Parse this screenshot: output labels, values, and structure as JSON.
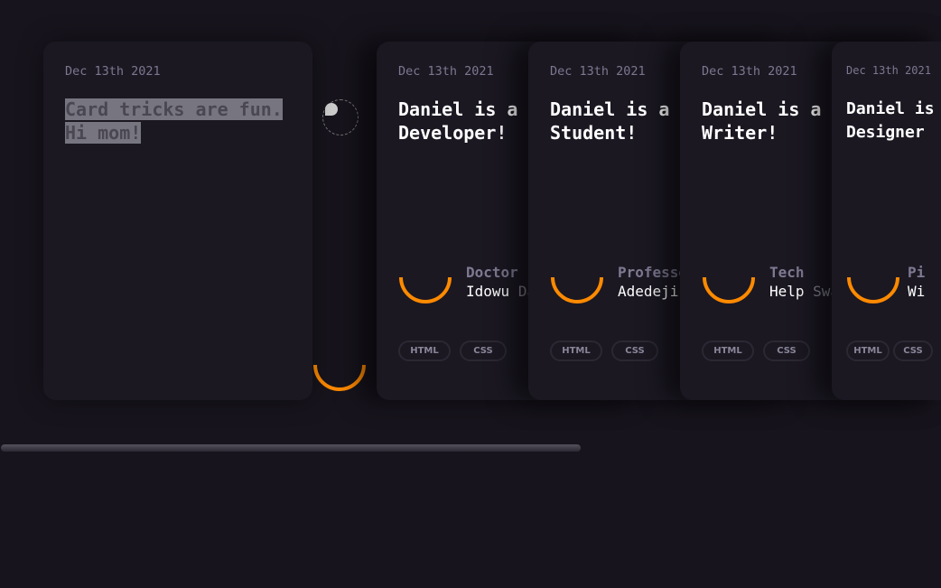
{
  "accent_color": "#ff8a00",
  "first_card": {
    "date": "Dec 13th 2021",
    "title_line1": "Card tricks are fun.",
    "title_line2": "Hi mom!"
  },
  "avatar_icon": "broken-image-icon",
  "cards": [
    {
      "date": "Dec 13th 2021",
      "title_line1": "Daniel is a",
      "title_line2": "Developer!",
      "role": "Doctor",
      "name_first": "Idowu",
      "name_rest": "Da",
      "tags": [
        "HTML",
        "CSS"
      ]
    },
    {
      "date": "Dec 13th 2021",
      "title_line1": "Daniel is a",
      "title_line2": "Student!",
      "role": "Professo",
      "name_first": "Adedeji",
      "name_rest": "",
      "tags": [
        "HTML",
        "CSS"
      ]
    },
    {
      "date": "Dec 13th 2021",
      "title_line1": "Daniel is a",
      "title_line2": "Writer!",
      "role": "Tech",
      "name_first": "Help",
      "name_rest": "Swa",
      "tags": [
        "HTML",
        "CSS"
      ]
    },
    {
      "date": "Dec 13th 2021",
      "title_line1": "Daniel is",
      "title_line2": "Designer",
      "role": "Pi",
      "name_first": "Wi",
      "name_rest": "",
      "tags": [
        "HTML",
        "CSS"
      ]
    }
  ]
}
